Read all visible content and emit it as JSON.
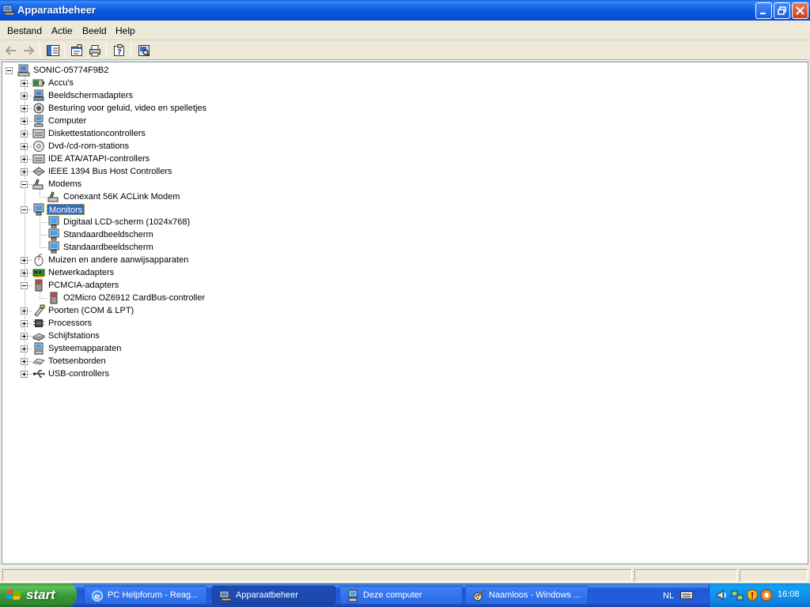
{
  "window": {
    "title": "Apparaatbeheer",
    "menu": [
      "Bestand",
      "Actie",
      "Beeld",
      "Help"
    ]
  },
  "tree": {
    "root": "SONIC-05774F9B2",
    "categories": [
      {
        "label": "Accu's",
        "icon": "battery-icon",
        "expanded": false
      },
      {
        "label": "Beeldschermadapters",
        "icon": "display-adapter-icon",
        "expanded": false
      },
      {
        "label": "Besturing voor geluid, video en spelletjes",
        "icon": "speaker-icon",
        "expanded": false
      },
      {
        "label": "Computer",
        "icon": "computer-icon",
        "expanded": false
      },
      {
        "label": "Diskettestationcontrollers",
        "icon": "floppy-controller-icon",
        "expanded": false
      },
      {
        "label": "Dvd-/cd-rom-stations",
        "icon": "cdrom-icon",
        "expanded": false
      },
      {
        "label": "IDE ATA/ATAPI-controllers",
        "icon": "ide-controller-icon",
        "expanded": false
      },
      {
        "label": "IEEE 1394 Bus Host Controllers",
        "icon": "firewire-icon",
        "expanded": false
      },
      {
        "label": "Modems",
        "icon": "modem-icon",
        "expanded": true,
        "children": [
          "Conexant 56K ACLink Modem"
        ]
      },
      {
        "label": "Monitors",
        "icon": "monitor-icon",
        "expanded": true,
        "selected": true,
        "children": [
          "Digitaal LCD-scherm (1024x768)",
          "Standaardbeeldscherm",
          "Standaardbeeldscherm"
        ]
      },
      {
        "label": "Muizen en andere aanwijsapparaten",
        "icon": "mouse-icon",
        "expanded": false
      },
      {
        "label": "Netwerkadapters",
        "icon": "network-card-icon",
        "expanded": false
      },
      {
        "label": "PCMCIA-adapters",
        "icon": "pcmcia-icon",
        "expanded": true,
        "children": [
          "O2Micro OZ6912 CardBus-controller"
        ]
      },
      {
        "label": "Poorten (COM & LPT)",
        "icon": "port-icon",
        "expanded": false
      },
      {
        "label": "Processors",
        "icon": "processor-icon",
        "expanded": false
      },
      {
        "label": "Schijfstations",
        "icon": "disk-drive-icon",
        "expanded": false
      },
      {
        "label": "Systeemapparaten",
        "icon": "system-device-icon",
        "expanded": false
      },
      {
        "label": "Toetsenborden",
        "icon": "keyboard-icon",
        "expanded": false
      },
      {
        "label": "USB-controllers",
        "icon": "usb-icon",
        "expanded": false
      }
    ]
  },
  "taskbar": {
    "start_label": "start",
    "tasks": [
      {
        "label": "PC Helpforum - Reag...",
        "icon": "internet-explorer-icon",
        "active": false
      },
      {
        "label": "Apparaatbeheer",
        "icon": "device-manager-icon",
        "active": true
      },
      {
        "label": "Deze computer",
        "icon": "my-computer-icon",
        "active": false
      },
      {
        "label": "Naamloos - Windows ...",
        "icon": "paint-icon",
        "active": false
      }
    ],
    "language": "NL",
    "clock": "16:08"
  },
  "colors": {
    "selection": "#316ac5",
    "titlebar": "#0a58e0",
    "start_button": "#3a9a3a"
  }
}
